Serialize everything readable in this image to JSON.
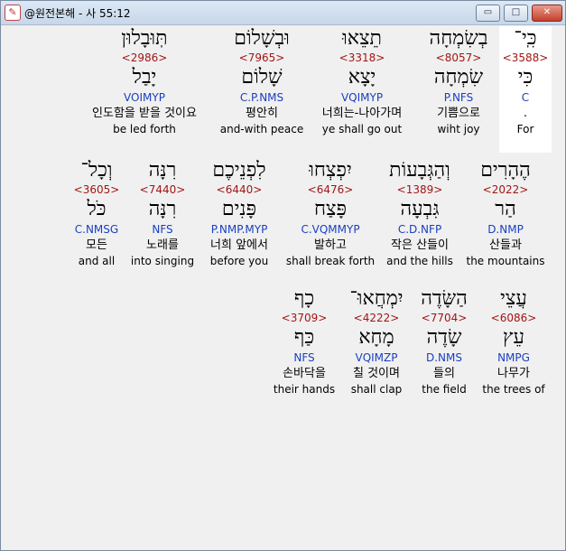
{
  "window": {
    "title": "@원전본해 - 사 55:12",
    "minimize_symbol": "▭",
    "maximize_symbol": "□",
    "close_symbol": "✕",
    "app_icon": "pen-icon"
  },
  "rows": [
    {
      "words": [
        {
          "heb": "כִּֽי־",
          "strong": "<3588>",
          "lemma": "כִּי",
          "morph": "C",
          "kor": ".",
          "eng": "For",
          "selected": true
        },
        {
          "heb": "בְשִׂמְחָה",
          "strong": "<8057>",
          "lemma": "שִׂמְחָה",
          "morph": "P.NFS",
          "kor": "기쁨으로",
          "eng": "wiht joy"
        },
        {
          "heb": "תֵצֵאוּ",
          "strong": "<3318>",
          "lemma": "יָצָא",
          "morph": "VQIMYP",
          "kor": "너희는-나아가며",
          "eng": "ye shall go out"
        },
        {
          "heb": "וּבְשָׁלוֹם",
          "strong": "<7965>",
          "lemma": "שָׁלוֹם",
          "morph": "C.P.NMS",
          "kor": "평안히",
          "eng": "and-with peace"
        },
        {
          "heb": "תּֽוּבָלוּן",
          "strong": "<2986>",
          "lemma": "יָבַל",
          "morph": "VOIMYP",
          "kor": "인도함을 받을 것이요",
          "eng": "be led forth"
        }
      ]
    },
    {
      "words": [
        {
          "heb": "הֶהָרִים",
          "strong": "<2022>",
          "lemma": "הַר",
          "morph": "D.NMP",
          "kor": "산들과",
          "eng": "the mountains"
        },
        {
          "heb": "וְהַגְּבָעוֹת",
          "strong": "<1389>",
          "lemma": "גִּבְעָה",
          "morph": "C.D.NFP",
          "kor": "작은 산들이",
          "eng": "and the hills"
        },
        {
          "heb": "יִפְצְחוּ",
          "strong": "<6476>",
          "lemma": "פָּצַח",
          "morph": "C.VQMMYP",
          "kor": "발하고",
          "eng": "shall break forth"
        },
        {
          "heb": "לִפְנֵיכֶם",
          "strong": "<6440>",
          "lemma": "פָּנִים",
          "morph": "P.NMP.MYP",
          "kor": "너희 앞에서",
          "eng": "before you"
        },
        {
          "heb": "רִנָּה",
          "strong": "<7440>",
          "lemma": "רִנָּה",
          "morph": "NFS",
          "kor": "노래를",
          "eng": "into singing"
        },
        {
          "heb": "וְכָל־",
          "strong": "<3605>",
          "lemma": "כֹּל",
          "morph": "C.NMSG",
          "kor": "모든",
          "eng": "and all"
        }
      ]
    },
    {
      "words": [
        {
          "heb": "עֲצֵי",
          "strong": "<6086>",
          "lemma": "עֵץ",
          "morph": "NMPG",
          "kor": "나무가",
          "eng": "the trees of"
        },
        {
          "heb": "הַשָּׂדֶה",
          "strong": "<7704>",
          "lemma": "שָׂדֶה",
          "morph": "D.NMS",
          "kor": "들의",
          "eng": "the field"
        },
        {
          "heb": "יִמְחֲאוּ־",
          "strong": "<4222>",
          "lemma": "מָחָא",
          "morph": "VQIMZP",
          "kor": "칠 것이며",
          "eng": "shall clap"
        },
        {
          "heb": "כָף",
          "strong": "<3709>",
          "lemma": "כַּף",
          "morph": "NFS",
          "kor": "손바닥을",
          "eng": "their hands"
        }
      ]
    }
  ]
}
